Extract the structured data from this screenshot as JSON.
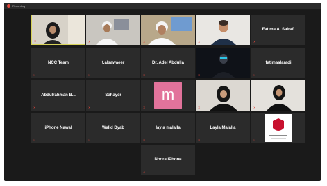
{
  "window": {
    "title": "Recording"
  },
  "tiles": {
    "t1": {
      "caption": ""
    },
    "t2": {
      "caption": ""
    },
    "t3": {
      "caption": ""
    },
    "t4": {
      "caption": ""
    },
    "t5": {
      "name": "Fatima Al Sairafi"
    },
    "t6": {
      "name": "NCC Team"
    },
    "t7": {
      "name": "t.alsawaeer"
    },
    "t8": {
      "name": "Dr. Adel Abdulla"
    },
    "t9": {
      "caption": ""
    },
    "t10": {
      "name": "fatimaalaradi"
    },
    "t11": {
      "name": "Abdulrahman  B..."
    },
    "t12": {
      "name": "Sahayer"
    },
    "t13": {
      "avatar_letter": "m",
      "caption": ""
    },
    "t14": {
      "caption": ""
    },
    "t15": {
      "caption": ""
    },
    "t16": {
      "name": "iPhone Nawal"
    },
    "t17": {
      "name": "Walid Dyab"
    },
    "t18": {
      "name": "layla malalla"
    },
    "t19": {
      "name": "Layla Malalla"
    },
    "t20": {
      "caption": ""
    },
    "t21": {
      "name": "Noora iPhone"
    }
  },
  "colors": {
    "active_border": "#d8d35a",
    "mic_muted": "#e0463c",
    "avatar_bg": "#e2739b"
  }
}
